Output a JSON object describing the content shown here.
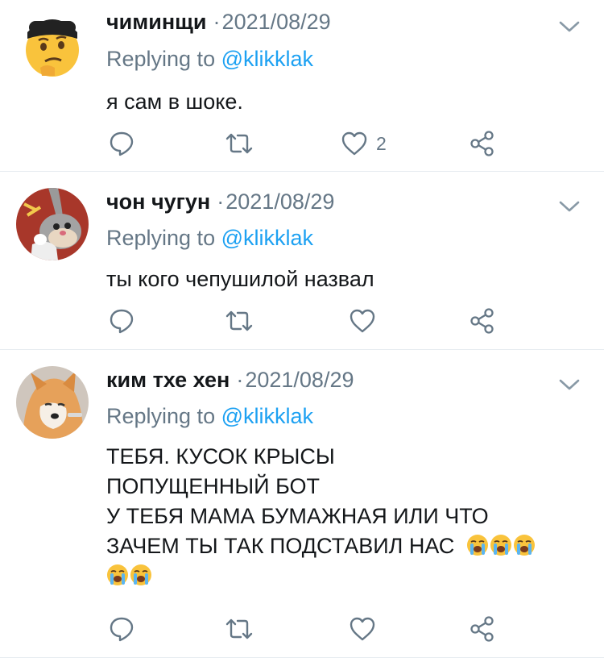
{
  "tweets": [
    {
      "name": "чиминщи",
      "dot": "·",
      "date": "2021/08/29",
      "reply_prefix": "Replying to ",
      "reply_handle": "@klikklak",
      "lines": [
        "я сам в шоке."
      ],
      "like_count": "2",
      "avatar": "thinking-emoji-with-cap"
    },
    {
      "name": "чон чугун",
      "dot": "·",
      "date": "2021/08/29",
      "reply_prefix": "Replying to ",
      "reply_handle": "@klikklak",
      "lines": [
        "ты кого чепушилой назвал"
      ],
      "like_count": "",
      "avatar": "bugs-bunny-soviet"
    },
    {
      "name": "ким тхе хен",
      "dot": "·",
      "date": "2021/08/29",
      "reply_prefix": "Replying to ",
      "reply_handle": "@klikklak",
      "lines": [
        "ТЕБЯ. КУСОК КРЫСЫ",
        "ПОПУЩЕННЫЙ БОТ",
        "У ТЕБЯ МАМА БУМАЖНАЯ ИЛИ ЧТО",
        "ЗАЧЕМ ТЫ ТАК ПОДСТАВИЛ НАС"
      ],
      "emoji": "loudly-crying-face",
      "like_count": "",
      "avatar": "shiba-dog-photo"
    }
  ],
  "icons": {
    "reply": "reply-icon",
    "retweet": "retweet-icon",
    "like": "heart-icon",
    "share": "share-icon",
    "menu": "chevron-down-icon"
  },
  "colors": {
    "text": "#14171a",
    "muted": "#657786",
    "link": "#1da1f2",
    "divider": "#e6ecf0"
  }
}
